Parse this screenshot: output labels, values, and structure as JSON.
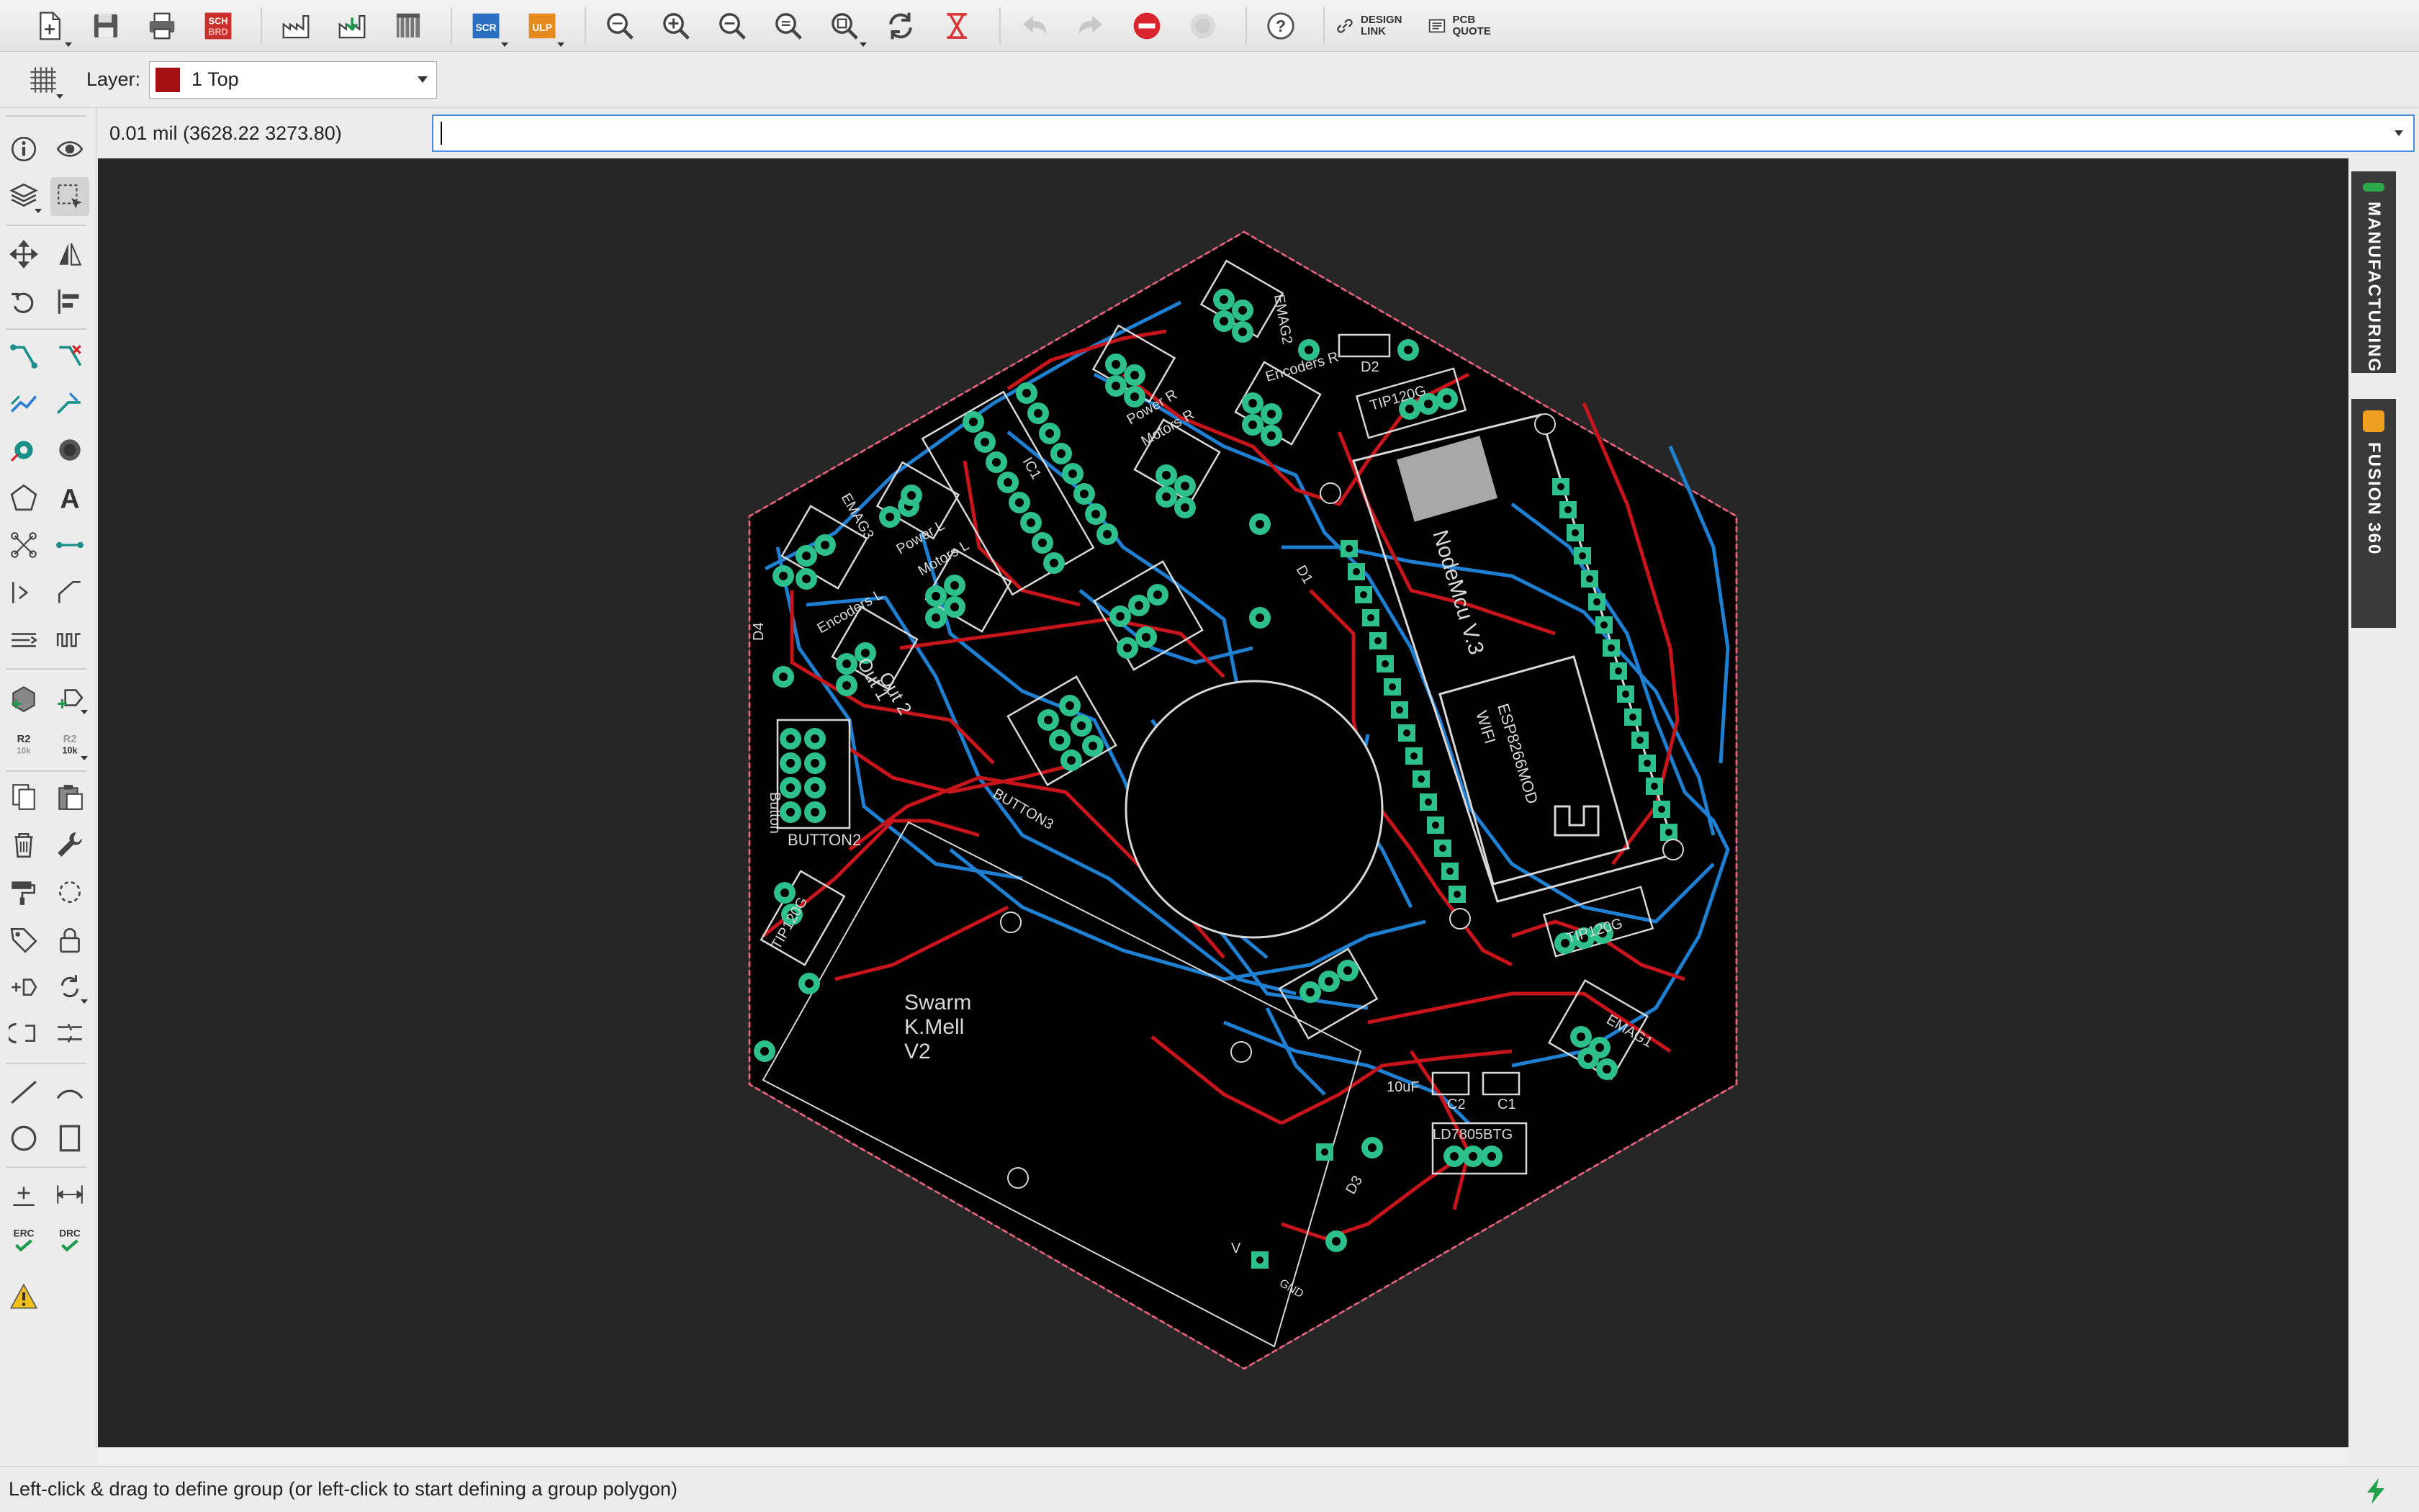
{
  "toolbar": {
    "items": [
      {
        "name": "new-file-icon"
      },
      {
        "name": "save-icon"
      },
      {
        "name": "print-icon"
      },
      {
        "name": "sch-brd-switch-icon",
        "label_top": "SCH",
        "label_bottom": "BRD"
      },
      {
        "name": "cam-processor-icon"
      },
      {
        "name": "manufacturing-icon"
      },
      {
        "name": "library-icon"
      },
      {
        "name": "script-icon",
        "label": "SCR"
      },
      {
        "name": "ulp-icon",
        "label": "ULP"
      },
      {
        "name": "zoom-fit-icon"
      },
      {
        "name": "zoom-in-icon"
      },
      {
        "name": "zoom-out-icon"
      },
      {
        "name": "zoom-select-icon"
      },
      {
        "name": "zoom-last-icon"
      },
      {
        "name": "redraw-icon"
      },
      {
        "name": "cancel-command-icon"
      },
      {
        "name": "undo-icon"
      },
      {
        "name": "redo-icon"
      },
      {
        "name": "stop-icon"
      },
      {
        "name": "go-icon"
      },
      {
        "name": "help-icon"
      }
    ],
    "design_link_line1": "DESIGN",
    "design_link_line2": "LINK",
    "pcb_quote_line1": "PCB",
    "pcb_quote_line2": "QUOTE"
  },
  "layer_bar": {
    "label": "Layer:",
    "selected_layer": "1 Top",
    "selected_color": "#a40f12"
  },
  "command_bar": {
    "coordinates": "0.01 mil (3628.22 3273.80)",
    "input_value": ""
  },
  "right_panel": {
    "tabs": [
      "MANUFACTURING",
      "FUSION 360"
    ]
  },
  "board": {
    "silkscreen": [
      "Swarm",
      "K.Mell",
      "V2",
      "NodeMcu V.3",
      "ESP8266MOD",
      "WIFI",
      "TIP120G",
      "TIP120G",
      "TIP120G",
      "EMAG1",
      "EMAG2",
      "EMAG3",
      "Power L",
      "Power R",
      "Motors L",
      "Motors R",
      "Encoders L",
      "Encoders R",
      "Out 1",
      "Out 2",
      "BUTTON2",
      "BUTTON3",
      "Button",
      "LD7805BTG",
      "10uF",
      "C1",
      "C2",
      "D1",
      "D2",
      "D3",
      "D4",
      "GND",
      "V",
      "IC1"
    ],
    "colors": {
      "background": "#000000",
      "top_copper": "#c8141b",
      "bottom_copper": "#1f7fd0",
      "pads": "#2ec08a",
      "silk": "#d8d8d8",
      "outline": "#e04060"
    }
  },
  "status": {
    "message": "Left-click & drag to define group (or left-click to start defining a group polygon)"
  }
}
